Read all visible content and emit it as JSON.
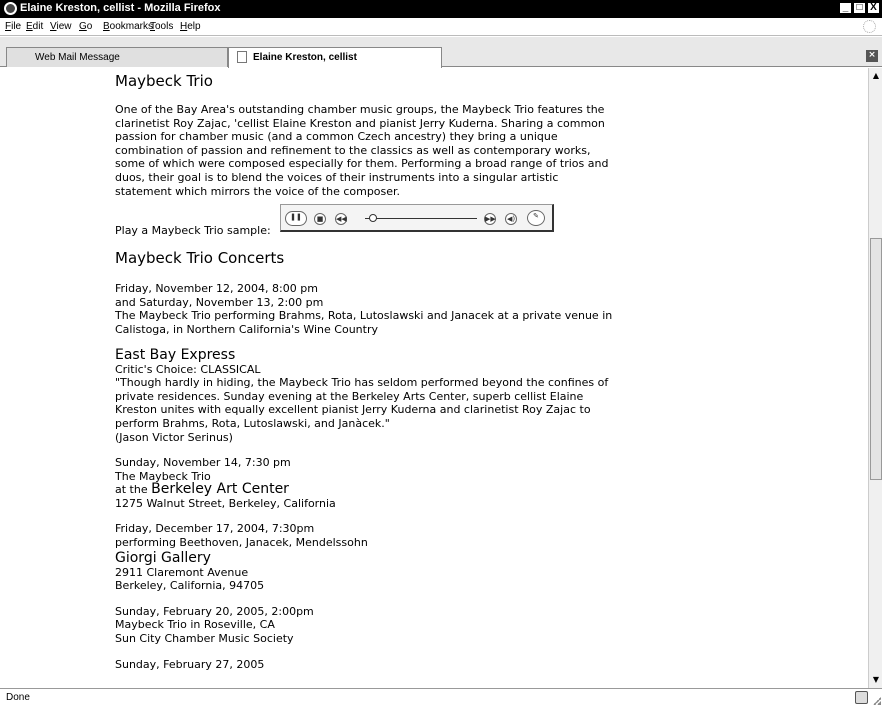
{
  "window": {
    "title": "Elaine Kreston, cellist - Mozilla Firefox",
    "buttons": {
      "minimize": "_",
      "maximize": "□",
      "close": "X"
    }
  },
  "menu": {
    "items": [
      "File",
      "Edit",
      "View",
      "Go",
      "Bookmarks",
      "Tools",
      "Help"
    ]
  },
  "tabs": [
    {
      "label": "Web Mail Message",
      "active": false
    },
    {
      "label": "Elaine Kreston, cellist",
      "active": true
    }
  ],
  "content": {
    "heading": "Maybeck Trio",
    "intro": [
      "One of the Bay Area's outstanding chamber music groups, the Maybeck Trio features the",
      "clarinetist Roy Zajac, 'cellist Elaine Kreston and pianist Jerry Kuderna. Sharing a common",
      "passion for chamber music (and a common Czech ancestry) they bring a unique",
      "combination of passion and refinement to the classics as well as contemporary works,",
      "some of which were composed especially for them. Performing a broad range of trios and",
      "duos, their goal is to blend the voices of their instruments into a singular artistic",
      "statement which mirrors the voice of the composer."
    ],
    "sample_label": "Play a Maybeck Trio sample:",
    "player": {
      "progress": 0.07
    },
    "concerts_heading": "Maybeck Trio Concerts",
    "event1": [
      "Friday, November 12, 2004, 8:00 pm",
      "and Saturday, November 13, 2:00 pm",
      "The Maybeck Trio performing Brahms, Rota, Lutoslawski and Janacek at a private venue in",
      "Calistoga, in Northern California's Wine Country"
    ],
    "review": {
      "source": "East Bay Express",
      "subtitle": "Critic's Choice: CLASSICAL",
      "lines": [
        "\"Though hardly in hiding, the Maybeck Trio has seldom performed beyond the confines of",
        "private residences. Sunday evening at the Berkeley Arts Center, superb cellist Elaine",
        "Kreston unites with equally excellent pianist Jerry Kuderna and clarinetist Roy Zajac to",
        "perform Brahms, Rota, Lutoslawski, and Janàcek.\""
      ],
      "author": "(Jason Victor Serinus)"
    },
    "event2": {
      "date": "Sunday, November 14, 7:30 pm",
      "performer": "The Maybeck Trio",
      "at_prefix": "at the",
      "venue": "Berkeley Art Center",
      "address": "1275 Walnut Street, Berkeley, California"
    },
    "event3": {
      "date": "Friday, December 17, 2004, 7:30pm",
      "program": "performing Beethoven, Janacek, Mendelssohn",
      "venue": "Giorgi Gallery",
      "address1": "2911 Claremont Avenue",
      "address2": "Berkeley, California, 94705"
    },
    "event4": [
      "Sunday, February 20, 2005, 2:00pm",
      "Maybeck Trio in Roseville, CA",
      "Sun City Chamber Music Society"
    ],
    "event5": "Sunday, February 27, 2005"
  },
  "status": {
    "text": "Done"
  },
  "icons": {
    "app": "firefox-icon",
    "throbber": "throbber-icon",
    "tab_doc": "document-icon",
    "tab_close": "close-icon",
    "status": "connection-icon"
  }
}
